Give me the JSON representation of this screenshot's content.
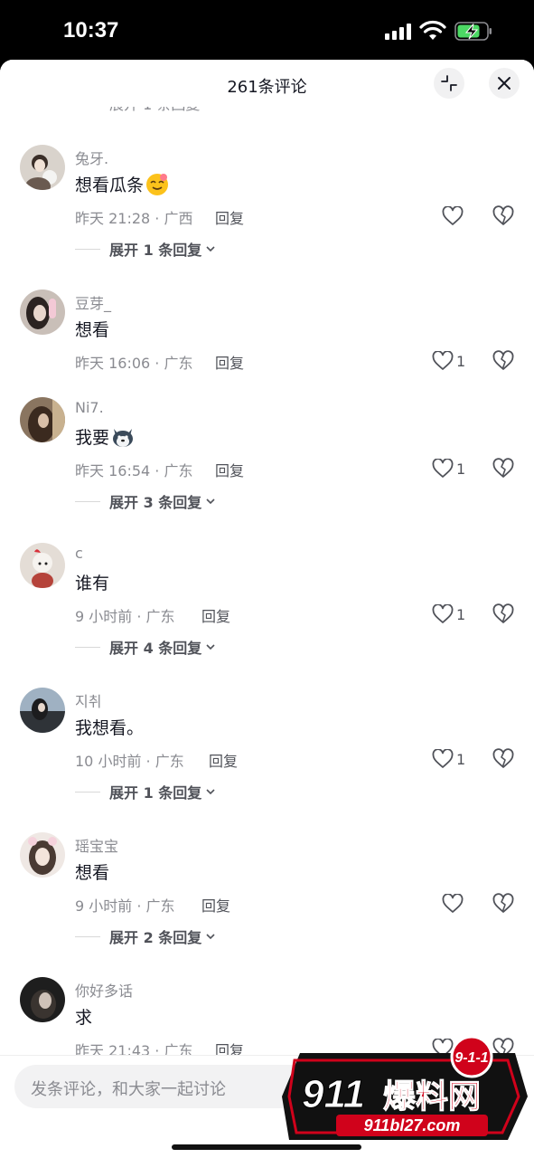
{
  "status_bar": {
    "time": "10:37"
  },
  "header": {
    "title": "261条评论"
  },
  "clipped_row_text": "展开 1 条回复",
  "comments": [
    {
      "username": "兔牙.",
      "text": "想看瓜条",
      "emoji": "drooling-face-emoji",
      "time_location": "昨天 21:28 · 广西",
      "reply_label": "回复",
      "likes": "",
      "expand_label": "展开 1 条回复"
    },
    {
      "username": "豆芽_",
      "text": "想看",
      "emoji": "",
      "time_location": "昨天 16:06 · 广东",
      "reply_label": "回复",
      "likes": "1",
      "expand_label": ""
    },
    {
      "username": "Ni7.",
      "text": "我要",
      "emoji": "husky-dog-emoji",
      "time_location": "昨天 16:54 · 广东",
      "reply_label": "回复",
      "likes": "1",
      "expand_label": "展开 3 条回复"
    },
    {
      "username": "c",
      "text": "谁有",
      "emoji": "",
      "time_location": "9 小时前 · 广东",
      "reply_label": "回复",
      "likes": "1",
      "expand_label": "展开 4 条回复"
    },
    {
      "username": "지취",
      "text": "我想看。",
      "emoji": "",
      "time_location": "10 小时前 · 广东",
      "reply_label": "回复",
      "likes": "1",
      "expand_label": "展开 1 条回复"
    },
    {
      "username": "瑶宝宝",
      "text": "想看",
      "emoji": "",
      "time_location": "9 小时前 · 广东",
      "reply_label": "回复",
      "likes": "",
      "expand_label": "展开 2 条回复"
    },
    {
      "username": "你好多话",
      "text": "求",
      "emoji": "",
      "time_location": "昨天 21:43 · 广东",
      "reply_label": "回复",
      "likes": "",
      "expand_label": ""
    }
  ],
  "input": {
    "placeholder": "发条评论，和大家一起讨论"
  },
  "watermark": {
    "badge": "9-1-1",
    "brand_number": "911",
    "brand_name": "爆料网",
    "url": "911bl27.com"
  },
  "colors": {
    "text_primary": "#161823",
    "text_secondary": "#8a8b91",
    "battery_green": "#4cd964",
    "watermark_red": "#d0021b"
  }
}
